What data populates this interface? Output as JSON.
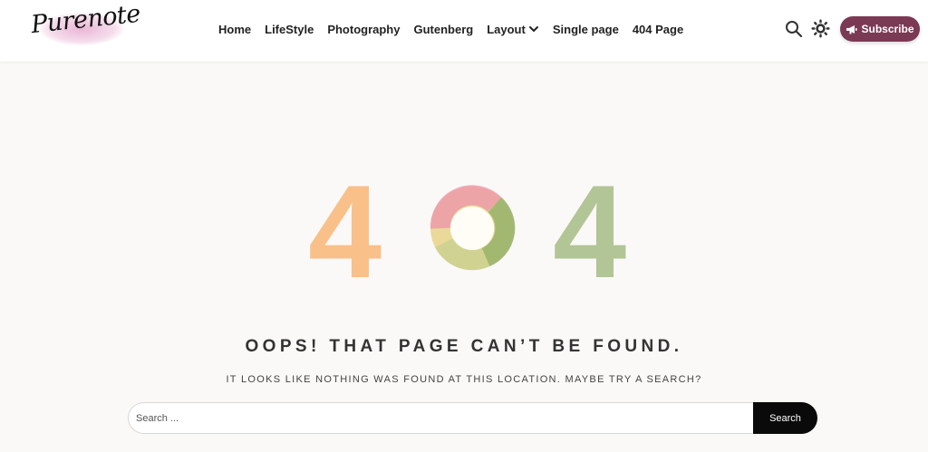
{
  "header": {
    "logo_text": "Purenote",
    "nav": [
      {
        "label": "Home"
      },
      {
        "label": "LifeStyle"
      },
      {
        "label": "Photography"
      },
      {
        "label": "Gutenberg"
      },
      {
        "label": "Layout",
        "has_dropdown": true
      },
      {
        "label": "Single page"
      },
      {
        "label": "404 Page"
      }
    ],
    "search_icon": "search-icon",
    "theme_icon": "sun-icon",
    "subscribe_label": "Subscribe",
    "subscribe_icon": "megaphone-icon"
  },
  "error": {
    "code_first_digit": "4",
    "code_last_digit": "4",
    "title": "OOPS! THAT PAGE CAN’T BE FOUND.",
    "message": "IT LOOKS LIKE NOTHING WAS FOUND AT THIS LOCATION. MAYBE TRY A SEARCH?"
  },
  "search": {
    "placeholder": "Search ...",
    "value": "",
    "button_label": "Search"
  },
  "colors": {
    "background": "#fbf9f7",
    "subscribe_bg": "#7b3a53",
    "digit_left": "#f9c08a",
    "digit_right": "#b2c596",
    "ring_pink": "#ee96a9",
    "ring_green": "#95b26a",
    "ring_yellow": "#e9d58f"
  }
}
